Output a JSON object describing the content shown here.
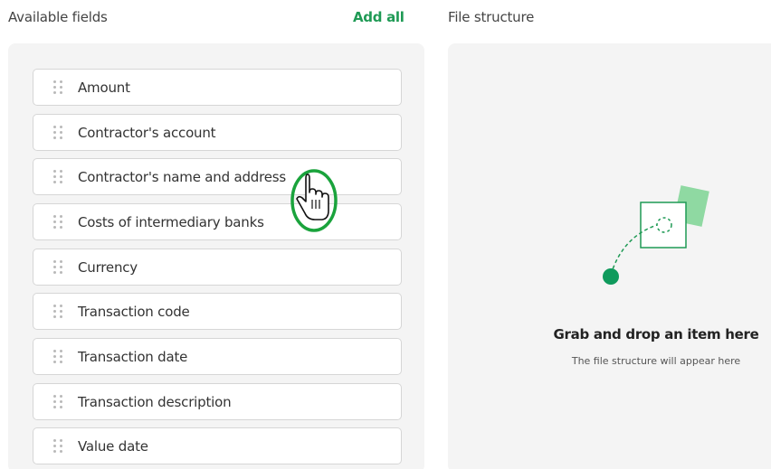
{
  "available": {
    "title": "Available fields",
    "add_all_label": "Add all",
    "fields": [
      "Amount",
      "Contractor's account",
      "Contractor's name and address",
      "Costs of intermediary banks",
      "Currency",
      "Transaction code",
      "Transaction date",
      "Transaction description",
      "Value date"
    ]
  },
  "structure": {
    "title": "File structure",
    "empty_title": "Grab and drop an item here",
    "empty_subtitle": "The file structure will appear here"
  },
  "colors": {
    "accent": "#1f9a55",
    "dot": "#0f9a5c",
    "card_back": "#8fd9a2",
    "panel_bg": "#f4f4f4"
  },
  "icons": {
    "drag_handle": "drag-handle-icon",
    "cursor": "hand-cursor-icon",
    "empty": "drop-illustration-icon"
  }
}
